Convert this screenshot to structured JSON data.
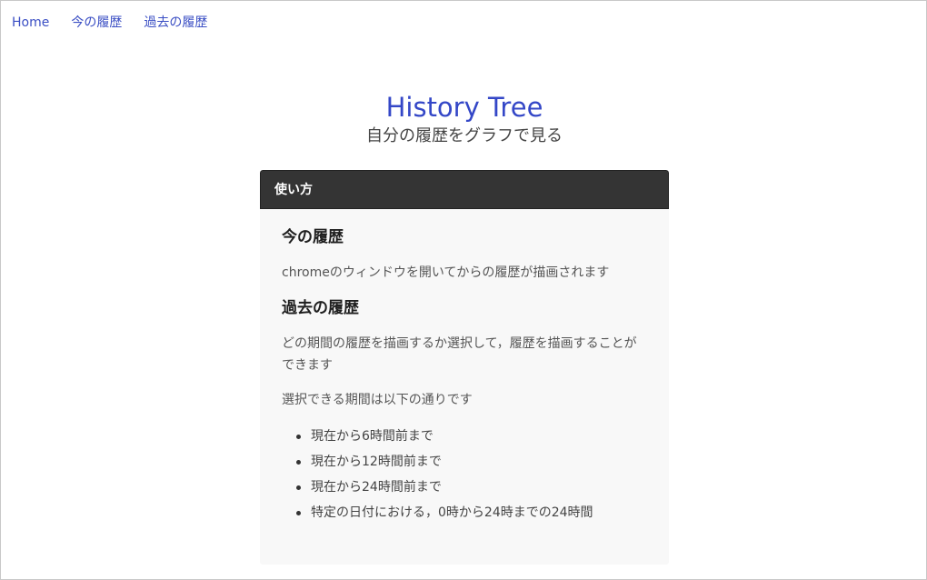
{
  "nav": {
    "items": [
      {
        "label": "Home"
      },
      {
        "label": "今の履歴"
      },
      {
        "label": "過去の履歴"
      }
    ]
  },
  "hero": {
    "title": "History Tree",
    "subtitle": "自分の履歴をグラフで見る"
  },
  "card": {
    "header": "使い方",
    "sections": [
      {
        "heading": "今の履歴",
        "paragraphs": [
          "chromeのウィンドウを開いてからの履歴が描画されます"
        ]
      },
      {
        "heading": "過去の履歴",
        "paragraphs": [
          "どの期間の履歴を描画するか選択して，履歴を描画することができます",
          "選択できる期間は以下の通りです"
        ],
        "list": [
          "現在から6時間前まで",
          "現在から12時間前まで",
          "現在から24時間前まで",
          "特定の日付における，0時から24時までの24時間"
        ]
      }
    ]
  },
  "colors": {
    "accent": "#3447c7",
    "nav_link": "#3b4fc4",
    "card_header_bg": "#343434",
    "card_bg": "#f8f8f8"
  }
}
